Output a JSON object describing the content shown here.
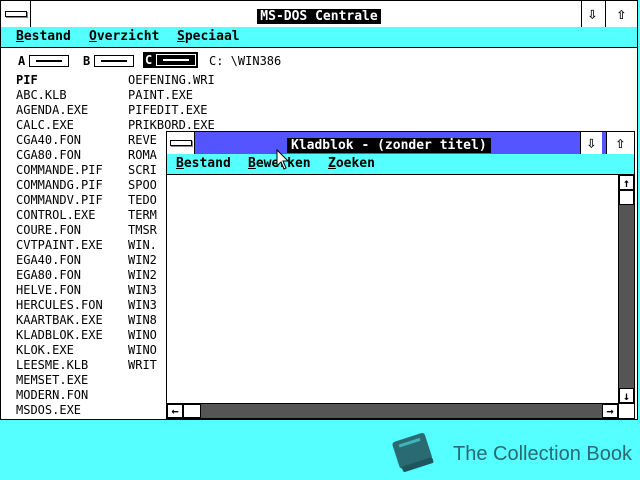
{
  "main_window": {
    "title": "MS-DOS Centrale",
    "menu": [
      {
        "underline": "B",
        "rest": "estand"
      },
      {
        "underline": "O",
        "rest": "verzicht"
      },
      {
        "underline": "S",
        "rest": "peciaal"
      }
    ],
    "drives": [
      {
        "letter": "A"
      },
      {
        "letter": "B"
      },
      {
        "letter": "C"
      }
    ],
    "current_path": "C: \\WIN386",
    "files_col1": [
      "PIF",
      "ABC.KLB",
      "AGENDA.EXE",
      "CALC.EXE",
      "CGA40.FON",
      "CGA80.FON",
      "COMMANDE.PIF",
      "COMMANDG.PIF",
      "COMMANDV.PIF",
      "CONTROL.EXE",
      "COURE.FON",
      "CVTPAINT.EXE",
      "EGA40.FON",
      "EGA80.FON",
      "HELVE.FON",
      "HERCULES.FON",
      "KAARTBAK.EXE",
      "KLADBLOK.EXE",
      "KLOK.EXE",
      "LEESME.KLB",
      "MEMSET.EXE",
      "MODERN.FON",
      "MSDOS.EXE"
    ],
    "files_col2": [
      "OEFENING.WRI",
      "PAINT.EXE",
      "PIFEDIT.EXE",
      "PRIKBORD.EXE",
      "REVE",
      "ROMA",
      "SCRI",
      "SPOO",
      "TEDO",
      "TERM",
      "TMSR",
      "WIN.",
      "WIN2",
      "WIN2",
      "WIN3",
      "WIN3",
      "WIN8",
      "WINO",
      "WINO",
      "WRIT"
    ]
  },
  "notepad": {
    "title": "Kladblok - (zonder titel)",
    "menu": [
      {
        "underline": "B",
        "rest": "estand"
      },
      {
        "underline": "B",
        "rest": "ewerken"
      },
      {
        "underline": "Z",
        "rest": "oeken"
      }
    ],
    "content": ""
  },
  "glyphs": {
    "down_arrow": "⇩",
    "up_arrow": "⇧",
    "scroll_up": "↑",
    "scroll_down": "↓",
    "scroll_left": "←",
    "scroll_right": "→"
  },
  "footer": {
    "brand": "The Collection Book",
    "icon": "book-icon",
    "color": "#2a6a73"
  },
  "colors": {
    "desktop": "#55ffff",
    "menubar": "#55ffff",
    "active_title": "#5555ff",
    "title_text_bg": "#000000",
    "scrollbar_track": "#555555"
  }
}
